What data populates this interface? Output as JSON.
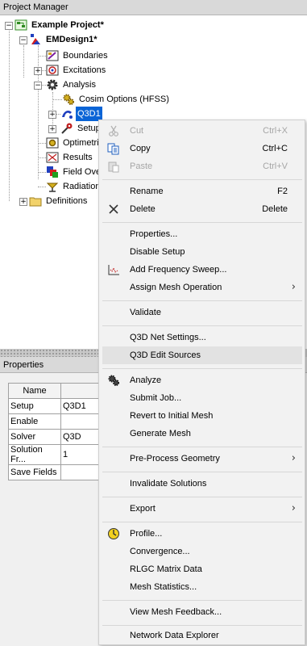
{
  "project_manager": {
    "title": "Project Manager",
    "tree": {
      "project": "Example Project*",
      "design": "EMDesign1*",
      "boundaries": "Boundaries",
      "excitations": "Excitations",
      "analysis": "Analysis",
      "cosim": "Cosim Options (HFSS)",
      "q3d1": "Q3D1",
      "setup": "Setup",
      "optimetrics": "Optimetri",
      "results": "Results",
      "field_overlays": "Field Ove",
      "radiation": "Radiation",
      "definitions": "Definitions"
    }
  },
  "properties": {
    "title": "Properties",
    "column_name": "Name",
    "rows": [
      {
        "name": "Setup",
        "value": "Q3D1"
      },
      {
        "name": "Enable",
        "value": ""
      },
      {
        "name": "Solver",
        "value": "Q3D"
      },
      {
        "name": "Solution Fr...",
        "value": "1"
      },
      {
        "name": "Save Fields",
        "value": ""
      }
    ]
  },
  "context_menu": {
    "cut": {
      "label": "Cut",
      "shortcut": "Ctrl+X"
    },
    "copy": {
      "label": "Copy",
      "shortcut": "Ctrl+C"
    },
    "paste": {
      "label": "Paste",
      "shortcut": "Ctrl+V"
    },
    "rename": {
      "label": "Rename",
      "shortcut": "F2"
    },
    "delete": {
      "label": "Delete",
      "shortcut": "Delete"
    },
    "properties": "Properties...",
    "disable_setup": "Disable Setup",
    "add_frequency_sweep": "Add Frequency Sweep...",
    "assign_mesh_operation": "Assign Mesh Operation",
    "validate": "Validate",
    "q3d_net_settings": "Q3D Net Settings...",
    "q3d_edit_sources": "Q3D Edit Sources",
    "analyze": "Analyze",
    "submit_job": "Submit Job...",
    "revert_mesh": "Revert to Initial Mesh",
    "generate_mesh": "Generate Mesh",
    "preprocess_geometry": "Pre-Process Geometry",
    "invalidate_solutions": "Invalidate Solutions",
    "export": "Export",
    "profile": "Profile...",
    "convergence": "Convergence...",
    "rlgc_matrix": "RLGC Matrix Data",
    "mesh_statistics": "Mesh Statistics...",
    "view_mesh_feedback": "View Mesh Feedback...",
    "network_data_explorer": "Network Data Explorer"
  }
}
